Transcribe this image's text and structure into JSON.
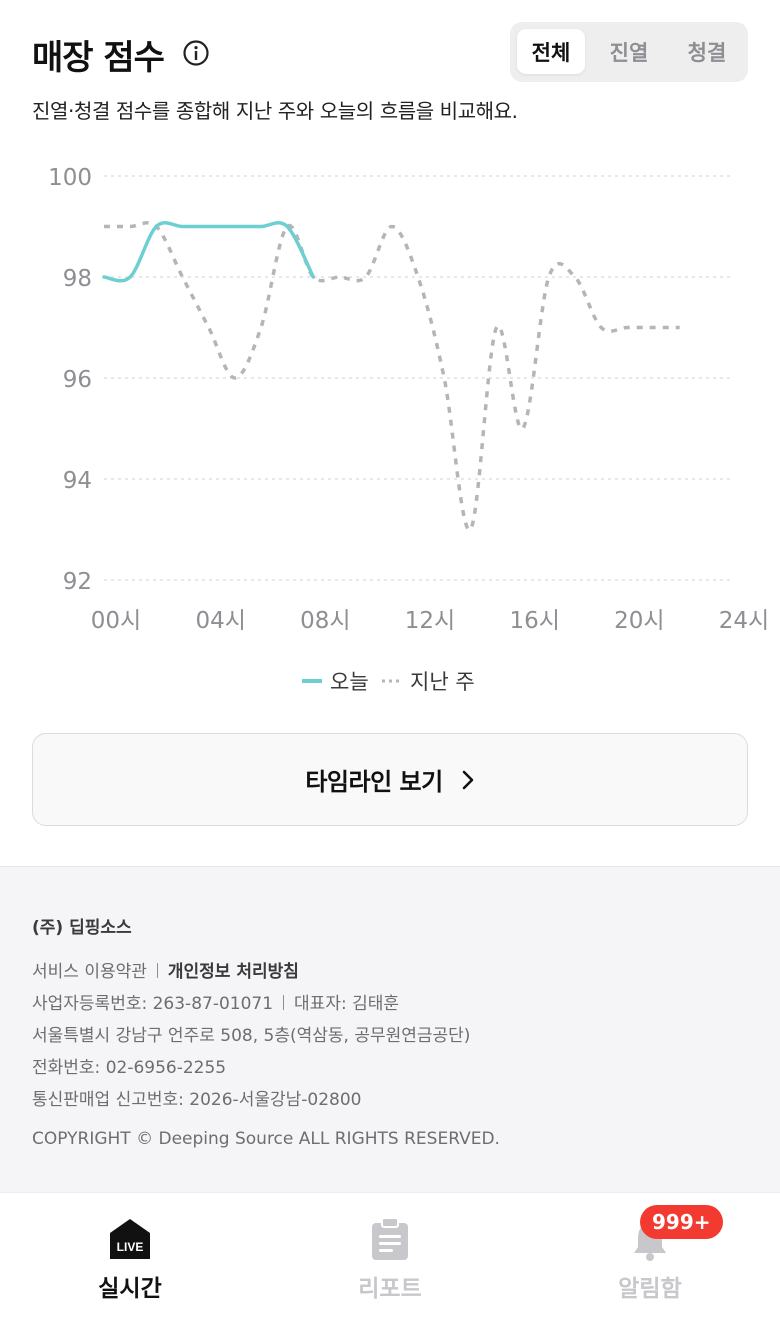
{
  "header": {
    "title": "매장 점수",
    "description": "진열·청결 점수를 종합해 지난 주와 오늘의 흐름을 비교해요.",
    "segments": [
      {
        "label": "전체",
        "active": true
      },
      {
        "label": "진열",
        "active": false
      },
      {
        "label": "청결",
        "active": false
      }
    ]
  },
  "chart_data": {
    "type": "line",
    "xlabel": "",
    "ylabel": "",
    "xlim": [
      0,
      24
    ],
    "ylim": [
      92,
      100
    ],
    "x_ticks": [
      0,
      4,
      8,
      12,
      16,
      20,
      24
    ],
    "x_tick_labels": [
      "00시",
      "04시",
      "08시",
      "12시",
      "16시",
      "20시",
      "24시"
    ],
    "y_ticks": [
      92,
      94,
      96,
      98,
      100
    ],
    "grid": true,
    "legend": "bottom-center",
    "series": [
      {
        "name": "오늘",
        "style": "solid",
        "color": "#6dcfd1",
        "x": [
          0,
          1,
          2,
          3,
          4,
          5,
          6,
          7,
          8
        ],
        "y": [
          98,
          98,
          99,
          99,
          99,
          99,
          99,
          99,
          98
        ]
      },
      {
        "name": "지난 주",
        "style": "dashed",
        "color": "#b5b5b5",
        "x": [
          0,
          1,
          2,
          3,
          4,
          5,
          6,
          7,
          8,
          9,
          10,
          11,
          12,
          13,
          14,
          15,
          16,
          17,
          18,
          19,
          20,
          21,
          22
        ],
        "y": [
          99,
          99,
          99,
          98,
          97,
          96,
          97,
          99,
          98,
          98,
          98,
          99,
          98,
          96,
          93,
          97,
          95,
          98,
          98,
          97,
          97,
          97,
          97
        ]
      }
    ]
  },
  "timeline_button": {
    "label": "타임라인 보기"
  },
  "footer": {
    "company": "(주) 딥핑소스",
    "terms": "서비스 이용약관",
    "privacy": "개인정보 처리방침",
    "business_no": "사업자등록번호: 263-87-01071",
    "ceo": "대표자: 김태훈",
    "address": "서울특별시 강남구 언주로 508, 5층(역삼동, 공무원연금공단)",
    "phone": "전화번호: 02-6956-2255",
    "mail_order": "통신판매업 신고번호: 2026-서울강남-02800",
    "copyright": "COPYRIGHT © Deeping Source ALL RIGHTS RESERVED."
  },
  "tabbar": {
    "tabs": [
      {
        "label": "실시간",
        "icon": "live-house-icon",
        "icon_text": "LIVE",
        "active": true
      },
      {
        "label": "리포트",
        "icon": "clipboard-icon",
        "active": false
      },
      {
        "label": "알림함",
        "icon": "bell-icon",
        "active": false,
        "badge": "999+"
      }
    ]
  },
  "colors": {
    "today_line": "#6dcfd1",
    "lastweek_line": "#b5b5b5",
    "badge": "#f33a30"
  }
}
